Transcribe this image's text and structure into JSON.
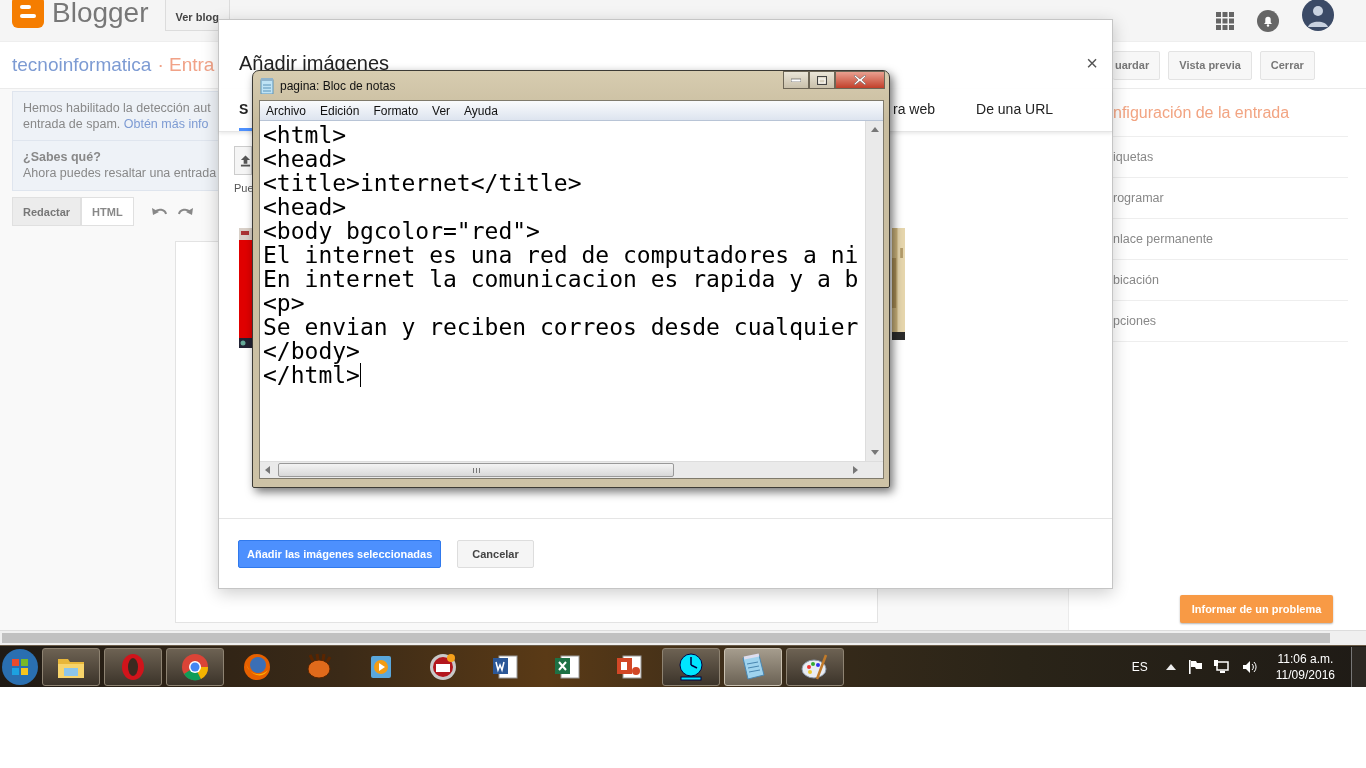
{
  "header": {
    "logo_text": "Blogger",
    "view_blog_button": "Ver blog"
  },
  "post_bar": {
    "blog_name": "tecnoinformatica",
    "page_crumb": "· Entra",
    "actions": [
      "uardar",
      "Vista previa",
      "Cerrar"
    ]
  },
  "notice": {
    "lines": [
      "Hemos habilitado la detección aut",
      "entrada de spam."
    ],
    "link": "Obtén más info"
  },
  "tip": {
    "title": "¿Sabes qué?",
    "text": "Ahora puedes resaltar una entrada"
  },
  "editor_modes": [
    {
      "label": "Redactar",
      "selected": true
    },
    {
      "label": "HTML",
      "selected": false
    }
  ],
  "settings": {
    "title": "nfiguración de la entrada",
    "items": [
      "iquetas",
      "rogramar",
      "nlace permanente",
      "bicación",
      "pciones"
    ]
  },
  "report_button": "Informar de un problema",
  "dialog": {
    "title": "Añadir imágenes",
    "close": "×",
    "tabs": [
      {
        "label": "S",
        "selected": true
      },
      {
        "label": "ra web",
        "selected": false
      },
      {
        "label": "De una URL",
        "selected": false
      }
    ],
    "upload_hint": "Pue",
    "buttons": [
      {
        "label": "Añadir las imágenes seleccionadas",
        "kind": "primary"
      },
      {
        "label": "Cancelar",
        "kind": "secondary"
      }
    ]
  },
  "notepad": {
    "title": "pagina: Bloc de notas",
    "menu": [
      "Archivo",
      "Edición",
      "Formato",
      "Ver",
      "Ayuda"
    ],
    "lines": [
      "<html>",
      "<head>",
      "<title>internet</title>",
      "<head>",
      "<body bgcolor=\"red\">",
      "El internet es una red de computadores a ni",
      "En internet la comunicacion es rapida y a b",
      "<p>",
      "Se envian y reciben correos desde cualquier",
      "</body>",
      "</html>"
    ]
  },
  "taskbar": {
    "apps": [
      {
        "kind": "folder",
        "running": true,
        "selected": false
      },
      {
        "kind": "opera",
        "running": true,
        "selected": false
      },
      {
        "kind": "chrome",
        "running": true,
        "selected": false
      },
      {
        "kind": "firefox",
        "running": false,
        "selected": false
      },
      {
        "kind": "glove",
        "running": false,
        "selected": false
      },
      {
        "kind": "media",
        "running": false,
        "selected": false
      },
      {
        "kind": "colosseum",
        "running": false,
        "selected": false
      },
      {
        "kind": "word",
        "running": false,
        "selected": false
      },
      {
        "kind": "excel",
        "running": false,
        "selected": false
      },
      {
        "kind": "powerpoint",
        "running": false,
        "selected": false
      },
      {
        "kind": "clock",
        "running": true,
        "selected": false
      },
      {
        "kind": "notepad",
        "running": true,
        "selected": true
      },
      {
        "kind": "paint",
        "running": true,
        "selected": false
      }
    ],
    "language": "ES",
    "time": "11:06 a.m.",
    "date": "11/09/2016"
  }
}
